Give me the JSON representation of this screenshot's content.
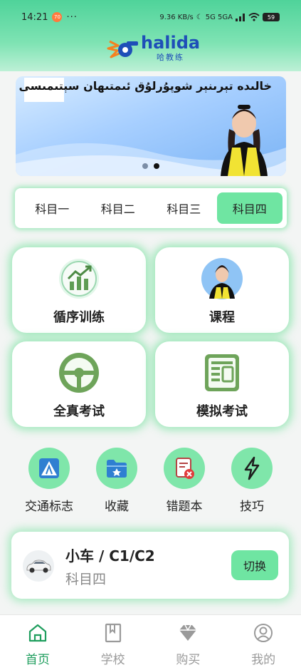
{
  "status_bar": {
    "time": "14:21",
    "badge": "70",
    "dots": "···",
    "speed": "9.36 KB/s",
    "network": "5G 5GA",
    "battery": "59"
  },
  "logo": {
    "name": "halida",
    "sub": "哈教练"
  },
  "banner": {
    "text": "خالىدە تېرىنېر شوپۇرلۇق ئىمتىھان سېتىمىسى",
    "slide_count": 2,
    "active_slide": 2
  },
  "subject_tabs": [
    {
      "label": "科目一",
      "active": false
    },
    {
      "label": "科目二",
      "active": false
    },
    {
      "label": "科目三",
      "active": false
    },
    {
      "label": "科目四",
      "active": true
    }
  ],
  "cards": [
    {
      "label": "循序训练",
      "icon": "bar-chart-trend-icon"
    },
    {
      "label": "课程",
      "icon": "instructor-avatar-icon"
    },
    {
      "label": "全真考试",
      "icon": "steering-wheel-icon"
    },
    {
      "label": "模拟考试",
      "icon": "exam-paper-icon"
    }
  ],
  "quick_actions": [
    {
      "label": "交通标志",
      "icon": "traffic-sign-icon"
    },
    {
      "label": "收藏",
      "icon": "favorites-folder-icon"
    },
    {
      "label": "错题本",
      "icon": "wrong-questions-icon"
    },
    {
      "label": "技巧",
      "icon": "lightning-icon"
    }
  ],
  "vehicle": {
    "title": "小车 / C1/C2",
    "subject": "科目四",
    "switch_label": "切换"
  },
  "tabbar": [
    {
      "label": "首页",
      "icon": "home-icon",
      "active": true
    },
    {
      "label": "学校",
      "icon": "book-icon",
      "active": false
    },
    {
      "label": "购买",
      "icon": "diamond-icon",
      "active": false
    },
    {
      "label": "我的",
      "icon": "user-icon",
      "active": false
    }
  ],
  "colors": {
    "accent": "#6fe5a2",
    "brand_blue": "#1e4fb8",
    "active_tab_text": "#1f9e5e"
  }
}
